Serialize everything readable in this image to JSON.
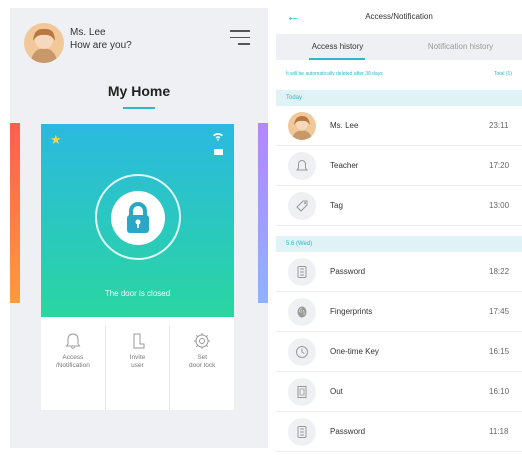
{
  "left": {
    "user_name": "Ms. Lee",
    "greeting": "How are you?",
    "home_title": "My Home",
    "door_status": "The door is closed",
    "actions": [
      {
        "label": "Access\n/Notification",
        "icon": "bell-icon"
      },
      {
        "label": "Invite\nuser",
        "icon": "invite-user-icon"
      },
      {
        "label": "Set\ndoor lock",
        "icon": "gear-icon"
      }
    ],
    "colors": {
      "accent": "#2fb6c9",
      "card_top": "#2bb9e0",
      "card_bottom": "#2ad6a0"
    }
  },
  "right": {
    "title": "Access/Notification",
    "tabs": [
      {
        "label": "Access history",
        "active": true
      },
      {
        "label": "Notification history",
        "active": false
      }
    ],
    "notice_left": "It will be automatically deleted after 30 days",
    "notice_right": "Total (1)",
    "sections": [
      {
        "label": "Today",
        "rows": [
          {
            "name": "Ms. Lee",
            "time": "23:11",
            "icon": "avatar"
          },
          {
            "name": "Teacher",
            "time": "17:20",
            "icon": "bell-icon"
          },
          {
            "name": "Tag",
            "time": "13:00",
            "icon": "tag-icon"
          }
        ]
      },
      {
        "label": "5.6 (Wed)",
        "rows": [
          {
            "name": "Password",
            "time": "18:22",
            "icon": "keypad-icon"
          },
          {
            "name": "Fingerprints",
            "time": "17:45",
            "icon": "fingerprint-icon"
          },
          {
            "name": "One-time Key",
            "time": "16:15",
            "icon": "clock-icon"
          },
          {
            "name": "Out",
            "time": "16:10",
            "icon": "door-out-icon"
          },
          {
            "name": "Password",
            "time": "11:18",
            "icon": "keypad-icon"
          }
        ]
      }
    ]
  }
}
